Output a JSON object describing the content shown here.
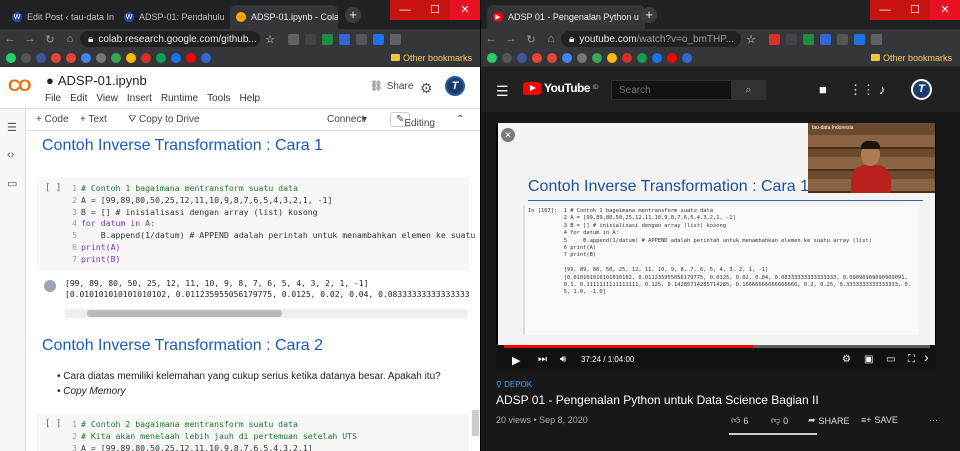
{
  "left_browser": {
    "tabs": [
      {
        "title": "Edit Post ‹ tau-data In",
        "close": "×"
      },
      {
        "title": "ADSP-01: Pendahulu",
        "close": "×"
      },
      {
        "title": "ADSP-01.ipynb - Cola",
        "close": "×"
      }
    ],
    "new_tab": "+",
    "url": "colab.research.google.com/github...",
    "bookmarks_label": "Other bookmarks"
  },
  "right_browser": {
    "tabs": [
      {
        "title": "ADSP 01 - Pengenalan Python u",
        "close": "×"
      }
    ],
    "new_tab": "+",
    "url_host": "youtube.com",
    "url_path": "/watch?v=o_bmTHP...",
    "bookmarks_label": "Other bookmarks"
  },
  "window_controls": {
    "minimize": "—",
    "maximize": "☐",
    "close": "✕"
  },
  "colab": {
    "logo": "CO",
    "notebook_title": "ADSP-01.ipynb",
    "menus": [
      "File",
      "Edit",
      "View",
      "Insert",
      "Runtime",
      "Tools",
      "Help"
    ],
    "share_label": "Share",
    "toolbar": {
      "code": "+ Code",
      "text": "+ Text",
      "copy": "Copy to Drive",
      "connect": "Connect",
      "editing": "Editing"
    },
    "heading1": "Contoh Inverse Transformation : Cara 1",
    "cell1_run": "[ ]",
    "cell1_lines": [
      "# Contoh 1 bagaimana mentransform suatu data",
      "A = [99,89,80,50,25,12,11,10,9,8,7,6,5,4,3,2,1, -1]",
      "B = [] # inisialisasi dengan array (list) kosong",
      "for datum in A:",
      "    B.append(1/datum) # APPEND adalah perintah untuk menambahkan elemen ke suatu",
      "print(A)",
      "print(B)"
    ],
    "output1": [
      "[99, 89, 80, 50, 25, 12, 11, 10, 9, 8, 7, 6, 5, 4, 3, 2, 1, -1]",
      "[0.010101010101010102, 0.011235955056179775, 0.0125, 0.02, 0.04, 0.08333333333333333"
    ],
    "heading2": "Contoh Inverse Transformation : Cara 2",
    "bullets": [
      "Cara diatas memiliki kelemahan yang cukup serius ketika datanya besar. Apakah itu?",
      "Copy Memory"
    ],
    "cell2_run": "[ ]",
    "cell2_lines": [
      "# Contoh 2 bagaimana mentransform suatu data",
      "# Kita akan menelaah lebih jauh di pertemuan setelah UTS",
      "A = [99,89,80,50,25,12,11,10,9,8,7,6,5,4,3,2,1]"
    ]
  },
  "youtube": {
    "logo": "YouTube",
    "logo_sup": "ID",
    "search_placeholder": "Search",
    "slide_title": "Contoh Inverse Transformation : Cara 1",
    "slide_code": "In [167]:  1 # Contoh 1 bagaimana mentransform suatu data\n           2 A = [99,89,80,50,25,12,11,10,9,8,7,6,5,4,3,2,1, -1]\n           3 B = [] # inisialisasi dengan array (list) kosong\n           4 for datum in A:\n           5     B.append(1/datum) # APPEND adalah perintah untuk menambahkan elemen ke suatu array (list)\n           6 print(A)\n           7 print(B)\n\n           [99, 89, 80, 50, 25, 12, 11, 10, 9, 8, 7, 6, 5, 4, 3, 2, 1, -1]\n           [0.010101010101010102, 0.011235955056179775, 0.0125, 0.02, 0.04, 0.08333333333333333, 0.09090909090909091,\n           0.1, 0.1111111111111111, 0.125, 0.14285714285714285, 0.16666666666666666, 0.2, 0.25, 0.3333333333333333, 0.\n           5, 1.0, -1.0]",
    "webcam_label": "tau-data Indonesia",
    "time": "37:24 / 1:04:00",
    "progress": 0.584,
    "location": "DEPOK",
    "title": "ADSP 01 - Pengenalan Python untuk Data Science Bagian II",
    "meta": "20 views • Sep 8, 2020",
    "likes": "6",
    "dislikes": "0",
    "like_ratio": 1.0,
    "share": "SHARE",
    "save": "SAVE"
  }
}
